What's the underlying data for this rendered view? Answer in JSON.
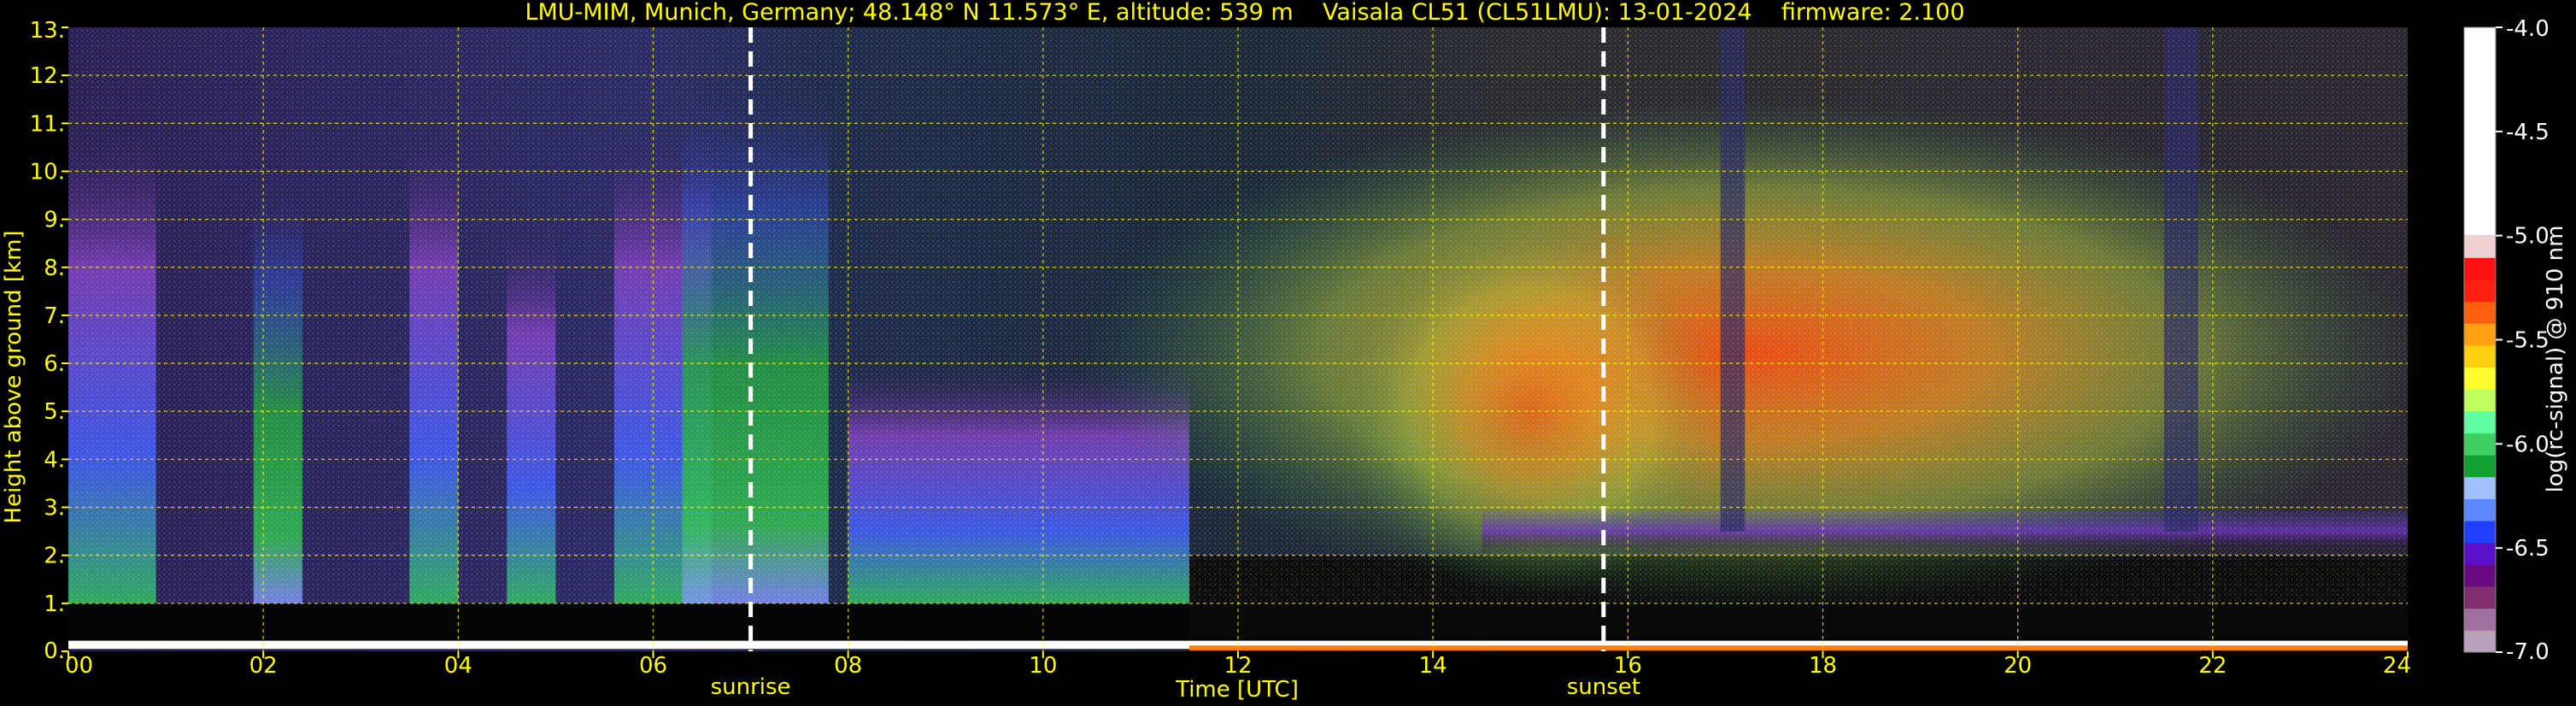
{
  "chart_data": {
    "type": "heatmap",
    "title": "LMU-MIM, Munich, Germany; 48.148° N 11.573° E, altitude: 539 m    Vaisala CL51 (CL51LMU): 13-01-2024    firmware: 2.100",
    "xlabel": "Time [UTC]",
    "ylabel": "Height above ground [km]",
    "colorbar_label": "log(rc-signal) @ 910 nm",
    "xlim": [
      0,
      24
    ],
    "ylim": [
      0,
      13
    ],
    "x_ticks": [
      "00",
      "02",
      "04",
      "06",
      "08",
      "10",
      "12",
      "14",
      "16",
      "18",
      "20",
      "22",
      "24"
    ],
    "y_ticks": [
      "0.",
      "1.",
      "2.",
      "3.",
      "4.",
      "5.",
      "6.",
      "7.",
      "8.",
      "9.",
      "10.",
      "11.",
      "12.",
      "13."
    ],
    "colorbar_range": [
      -7.0,
      -4.0
    ],
    "colorbar_ticks": [
      "-4.0",
      "-4.5",
      "-5.0",
      "-5.5",
      "-6.0",
      "-6.5",
      "-7.0"
    ],
    "grid": true,
    "markers": [
      {
        "label": "sunrise",
        "time": 7.0
      },
      {
        "label": "sunset",
        "time": 15.75
      }
    ],
    "colorscale": [
      "#b8a0b8",
      "#a070a0",
      "#80306f",
      "#6a0a80",
      "#5a10c8",
      "#2040ff",
      "#5e88ff",
      "#a0c0ff",
      "#10a030",
      "#40d060",
      "#60ffa0",
      "#c0ff60",
      "#ffff30",
      "#ffd010",
      "#ffa010",
      "#ff6010",
      "#ff2010",
      "#ff1010",
      "#f0d0d0",
      "#ffffff"
    ]
  }
}
